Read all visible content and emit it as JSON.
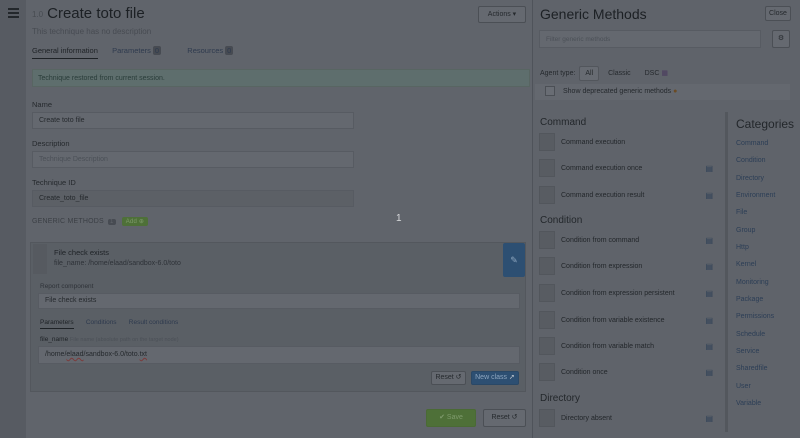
{
  "header": {
    "tag": "1.0",
    "title": "Create toto file",
    "subtitle": "This technique has no description",
    "actions_label": "Actions ▾"
  },
  "tabs": [
    {
      "label": "General information"
    },
    {
      "label": "Parameters",
      "badge": "0"
    },
    {
      "label": "Resources",
      "badge": "0"
    }
  ],
  "alert": "Technique restored from current session.",
  "form": {
    "name_label": "Name",
    "name_value": "Create toto file",
    "description_label": "Description",
    "description_placeholder": "Technique Description",
    "id_label": "Technique ID",
    "id_value": "Create_toto_file"
  },
  "generic_methods": {
    "label": "GENERIC METHODS",
    "count": "1",
    "add_label": "Add ⊕"
  },
  "method_card": {
    "title": "File check exists",
    "param_line": "file_name: /home/elaad/sandbox-6.0/toto",
    "report_label": "Report component",
    "report_value": "File check exists",
    "tabs": [
      "Parameters",
      "Conditions",
      "Result conditions"
    ],
    "param_name": "file_name",
    "param_hint": "File name (absolute path on the target node)",
    "path_prefix": "/home/",
    "path_user": "elaad",
    "path_mid": "/sandbox-6.0/toto.",
    "path_ext": "txt",
    "reset_label": "Reset ↺",
    "new_label": "New class"
  },
  "footer": {
    "save_label": "✔ Save",
    "reset_label": "Reset ↺"
  },
  "overlay_number": "1",
  "methods_panel": {
    "title": "Generic Methods",
    "close_label": "Close",
    "search_placeholder": "Filter generic methods",
    "agent_label": "Agent type:",
    "agent_options": [
      "All",
      "Classic",
      "DSC"
    ],
    "deprecated_label": "Show deprecated generic methods",
    "sections": [
      {
        "title": "Command",
        "items": [
          "Command execution",
          "Command execution once",
          "Command execution result"
        ]
      },
      {
        "title": "Condition",
        "items": [
          "Condition from command",
          "Condition from expression",
          "Condition from expression persistent",
          "Condition from variable existence",
          "Condition from variable match",
          "Condition once"
        ]
      },
      {
        "title": "Directory",
        "items": [
          "Directory absent"
        ]
      }
    ],
    "categories_title": "Categories",
    "categories": [
      "Command",
      "Condition",
      "Directory",
      "Environment",
      "File",
      "Group",
      "Http",
      "Kernel",
      "Monitoring",
      "Package",
      "Permissions",
      "Schedule",
      "Service",
      "Sharedfile",
      "User",
      "Variable"
    ]
  },
  "colors": {
    "save_green": "#4e7038",
    "edit_blue": "#2d4f72",
    "link_blue": "#2c3e56"
  }
}
